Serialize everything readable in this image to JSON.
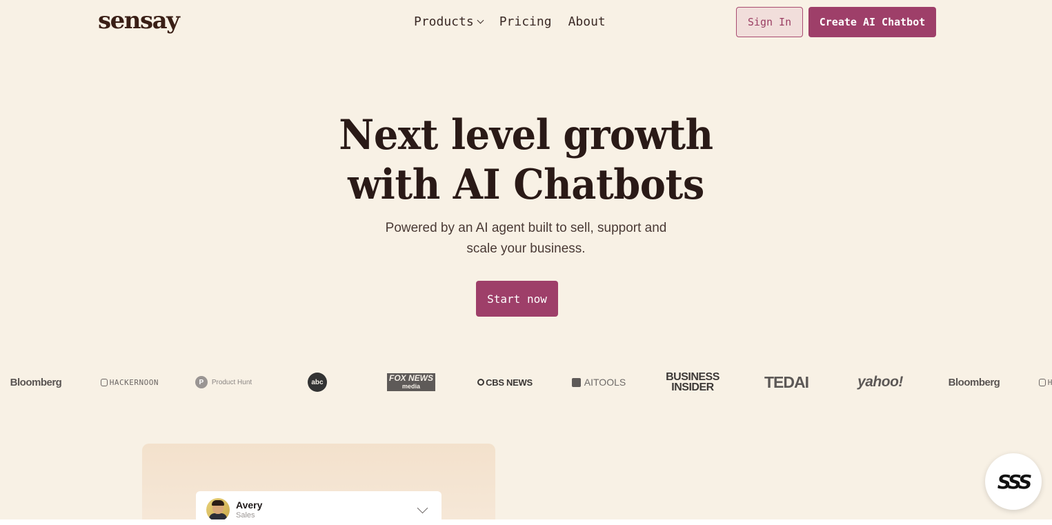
{
  "header": {
    "logo": "sensay",
    "nav": [
      {
        "label": "Products",
        "has_dropdown": true
      },
      {
        "label": "Pricing",
        "has_dropdown": false
      },
      {
        "label": "About",
        "has_dropdown": false
      }
    ],
    "sign_in": "Sign In",
    "create": "Create AI Chatbot"
  },
  "hero": {
    "title_line1": "Next level growth",
    "title_line2": "with AI Chatbots",
    "subtitle_line1": "Powered by an AI agent built to sell, support and",
    "subtitle_line2": "scale your business.",
    "cta": "Start now"
  },
  "press_logos": {
    "bloomberg": "Bloomberg",
    "hackernoon": "HACKERNOON",
    "producthunt": "Product Hunt",
    "producthunt_mark": "P",
    "abc": "abc",
    "fox_line1": "FOX NEWS",
    "fox_line2": "media",
    "cbs": "CBS NEWS",
    "aitools": "AITOOLS",
    "bi_line1": "BUSINESS",
    "bi_line2": "INSIDER",
    "ted": "TEDAI",
    "yahoo": "yahoo!"
  },
  "preview": {
    "agent_name": "Avery",
    "agent_role": "Sales"
  },
  "chat_badge": "SSS",
  "colors": {
    "background": "#f8f1e5",
    "accent": "#9e3f69",
    "sign_in_bg": "#f1dedb",
    "text": "#2c1c19"
  }
}
